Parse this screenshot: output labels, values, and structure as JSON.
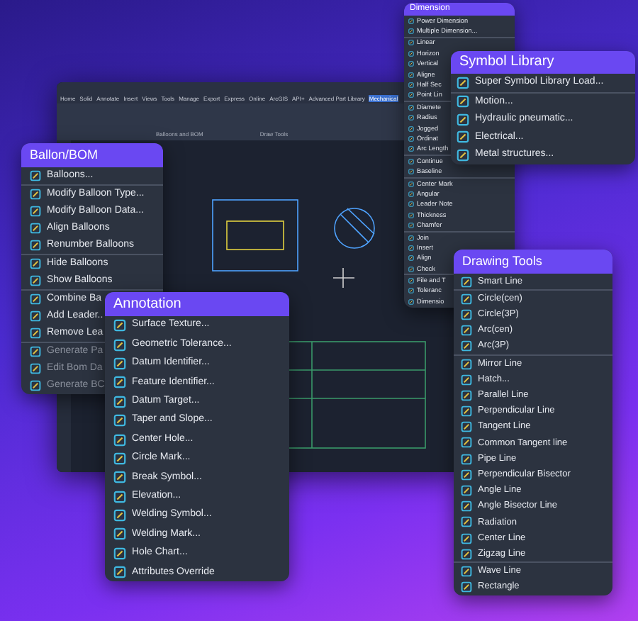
{
  "cad_window": {
    "ribbon_tabs": [
      {
        "label": "Home",
        "selected": false
      },
      {
        "label": "Solid",
        "selected": false
      },
      {
        "label": "Annotate",
        "selected": false
      },
      {
        "label": "Insert",
        "selected": false
      },
      {
        "label": "Views",
        "selected": false
      },
      {
        "label": "Tools",
        "selected": false
      },
      {
        "label": "Manage",
        "selected": false
      },
      {
        "label": "Export",
        "selected": false
      },
      {
        "label": "Express",
        "selected": false
      },
      {
        "label": "Online",
        "selected": false
      },
      {
        "label": "ArcGIS",
        "selected": false
      },
      {
        "label": "API+",
        "selected": false
      },
      {
        "label": "Advanced Part Library",
        "selected": false
      },
      {
        "label": "Mechanical",
        "selected": true
      }
    ],
    "ribbon_groups": [
      "Balloons and BOM",
      "Draw Tools"
    ]
  },
  "dimension_menu": {
    "title": "Dimension",
    "groups": [
      [
        "Power Dimension",
        "Multiple Dimension..."
      ],
      [
        "Linear",
        "Horizon",
        "Vertical",
        "Aligne",
        "Half Sec",
        "Point Lin"
      ],
      [
        "Diamete",
        "Radius",
        "Jogged",
        "Ordinat",
        "Arc Length"
      ],
      [
        "Continue",
        "Baseline"
      ],
      [
        "Center Mark",
        "Angular",
        "Leader Note",
        "Thickness",
        "Chamfer"
      ],
      [
        "Join",
        "Insert",
        "Align",
        "Check"
      ],
      [
        "File and T",
        "Toleranc",
        "Dimensio"
      ]
    ]
  },
  "symbol_library": {
    "title": "Symbol Library",
    "groups": [
      [
        "Super Symbol Library Load..."
      ],
      [
        "Motion...",
        "Hydraulic pneumatic...",
        "Electrical...",
        "Metal structures..."
      ]
    ]
  },
  "ballon_bom": {
    "title": "Ballon/BOM",
    "groups": [
      {
        "items": [
          {
            "label": "Balloons...",
            "disabled": false
          }
        ]
      },
      {
        "items": [
          {
            "label": "Modify Balloon Type...",
            "disabled": false
          },
          {
            "label": "Modify Balloon Data...",
            "disabled": false
          },
          {
            "label": "Align Balloons",
            "disabled": false
          },
          {
            "label": "Renumber Balloons",
            "disabled": false
          }
        ]
      },
      {
        "items": [
          {
            "label": "Hide Balloons",
            "disabled": false
          },
          {
            "label": "Show Balloons",
            "disabled": false
          }
        ]
      },
      {
        "items": [
          {
            "label": "Combine Ba",
            "disabled": false
          },
          {
            "label": "Add Leader..",
            "disabled": false
          },
          {
            "label": "Remove Lea",
            "disabled": false
          }
        ]
      },
      {
        "items": [
          {
            "label": "Generate Pa",
            "disabled": true
          },
          {
            "label": "Edit Bom Da",
            "disabled": true
          },
          {
            "label": "Generate BC",
            "disabled": true
          }
        ]
      }
    ]
  },
  "annotation": {
    "title": "Annotation",
    "groups": [
      [
        "Surface Texture...",
        "Geometric Tolerance...",
        "Datum Identifier...",
        "Feature Identifier...",
        "Datum Target...",
        "Taper and Slope...",
        "Center Hole...",
        "Circle Mark...",
        "Break Symbol...",
        "Elevation...",
        "Welding Symbol...",
        "Welding Mark...",
        "Hole Chart...",
        "Attributes Override"
      ]
    ]
  },
  "drawing_tools": {
    "title": "Drawing Tools",
    "groups": [
      [
        "Smart Line"
      ],
      [
        "Circle(cen)",
        "Circle(3P)",
        "Arc(cen)",
        "Arc(3P)"
      ],
      [
        "Mirror Line",
        "Hatch...",
        "Parallel Line",
        "Perpendicular Line",
        "Tangent Line",
        "Common Tangent line",
        "Pipe Line",
        "Perpendicular Bisector",
        "Angle Line",
        "Angle Bisector Line",
        "Radiation",
        "Center Line",
        "Zigzag Line"
      ],
      [
        "Wave Line",
        "Rectangle"
      ]
    ]
  }
}
